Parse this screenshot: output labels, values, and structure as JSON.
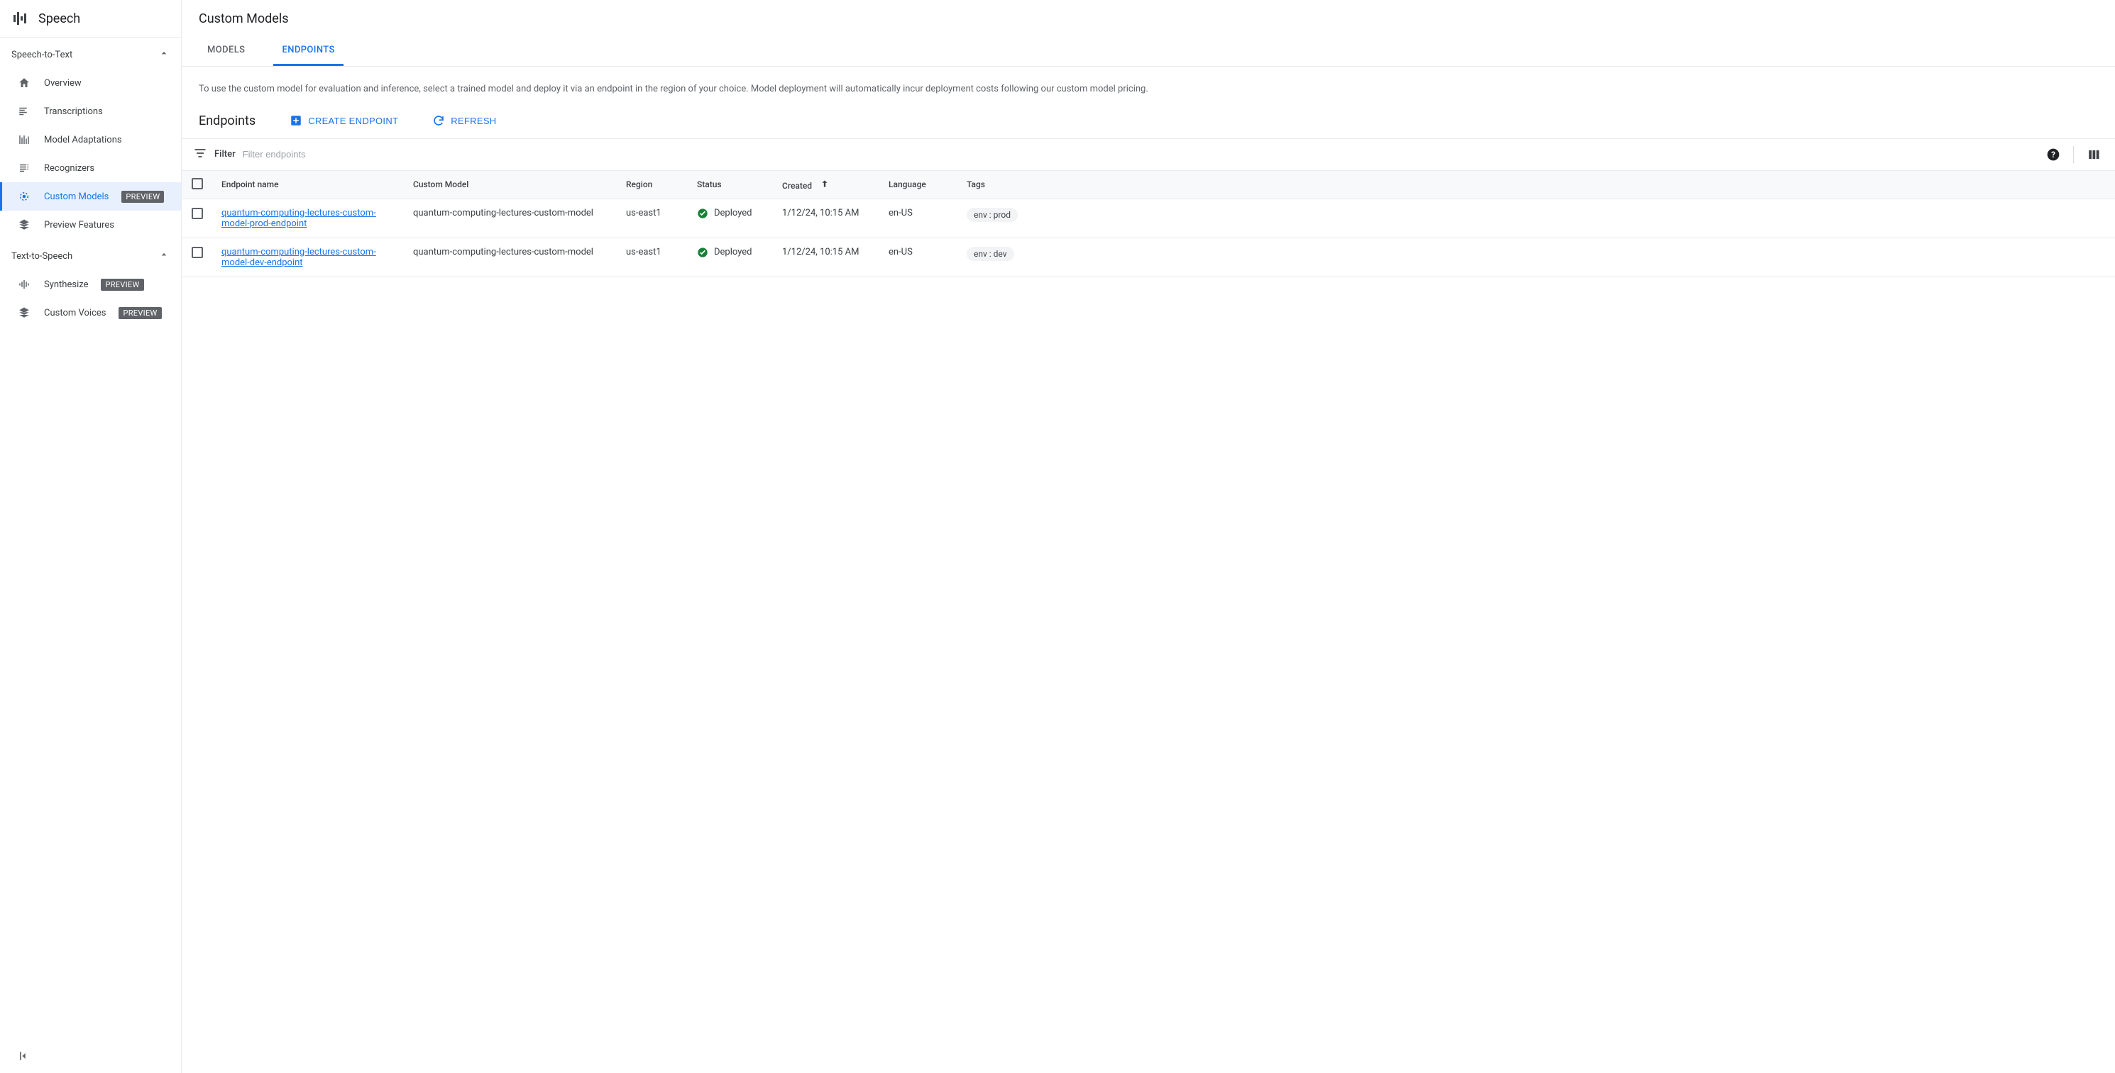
{
  "sidebar": {
    "app_title": "Speech",
    "sections": {
      "stt": {
        "label": "Speech-to-Text",
        "items": [
          {
            "label": "Overview"
          },
          {
            "label": "Transcriptions"
          },
          {
            "label": "Model Adaptations"
          },
          {
            "label": "Recognizers"
          },
          {
            "label": "Custom Models",
            "preview": "PREVIEW"
          },
          {
            "label": "Preview Features"
          }
        ]
      },
      "tts": {
        "label": "Text-to-Speech",
        "items": [
          {
            "label": "Synthesize",
            "preview": "PREVIEW"
          },
          {
            "label": "Custom Voices",
            "preview": "PREVIEW"
          }
        ]
      }
    }
  },
  "page": {
    "title": "Custom Models",
    "tabs": {
      "models": "MODELS",
      "endpoints": "ENDPOINTS"
    },
    "description": "To use the custom model for evaluation and inference, select a trained model and deploy it via an endpoint in the region of your choice. Model deployment will automatically incur deployment costs following our custom model pricing.",
    "section_title": "Endpoints",
    "actions": {
      "create": "CREATE ENDPOINT",
      "refresh": "REFRESH"
    },
    "filter": {
      "label": "Filter",
      "placeholder": "Filter endpoints"
    }
  },
  "table": {
    "headers": {
      "name": "Endpoint name",
      "model": "Custom Model",
      "region": "Region",
      "status": "Status",
      "created": "Created",
      "language": "Language",
      "tags": "Tags"
    },
    "rows": [
      {
        "name": "quantum-computing-lectures-custom-model-prod-endpoint",
        "model": "quantum-computing-lectures-custom-model",
        "region": "us-east1",
        "status": "Deployed",
        "created": "1/12/24, 10:15 AM",
        "language": "en-US",
        "tag": "env : prod"
      },
      {
        "name": "quantum-computing-lectures-custom-model-dev-endpoint",
        "model": "quantum-computing-lectures-custom-model",
        "region": "us-east1",
        "status": "Deployed",
        "created": "1/12/24, 10:15 AM",
        "language": "en-US",
        "tag": "env : dev"
      }
    ]
  }
}
